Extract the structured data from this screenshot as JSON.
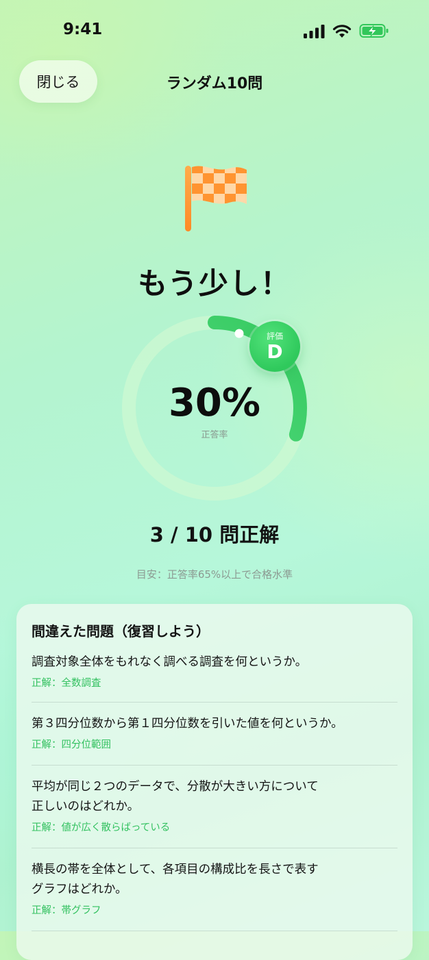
{
  "status_bar": {
    "time": "9:41",
    "icons": [
      "signal-icon",
      "wifi-icon",
      "battery-charging-icon"
    ]
  },
  "header": {
    "close_label": "閉じる",
    "title": "ランダム10問"
  },
  "result": {
    "icon": "checkered-flag-icon",
    "heading": "もう少し！",
    "percent": "30%",
    "percent_value": 30,
    "percent_caption": "正答率",
    "grade_label": "評価",
    "grade": "D",
    "correct_count": "3 / 10 問正解",
    "guideline": "目安：正答率65%以上で合格水準"
  },
  "review": {
    "title": "間違えた問題（復習しよう）",
    "items": [
      {
        "question_lines": [
          "調査対象全体をもれなく調べる調査を何というか。"
        ],
        "answer": "正解：全数調査"
      },
      {
        "question_lines": [
          "第３四分位数から第１四分位数を引いた値を何というか。"
        ],
        "answer": "正解：四分位範囲"
      },
      {
        "question_lines": [
          "平均が同じ２つのデータで、分散が大きい方について",
          "正しいのはどれか。"
        ],
        "answer": "正解：値が広く散らばっている"
      },
      {
        "question_lines": [
          "横長の帯を全体として、各項目の構成比を長さで表す",
          "グラフはどれか。"
        ],
        "answer": "正解：帯グラフ"
      }
    ]
  },
  "colors": {
    "accent_green": "#33c160",
    "flag_orange": "#ff9a3c"
  }
}
